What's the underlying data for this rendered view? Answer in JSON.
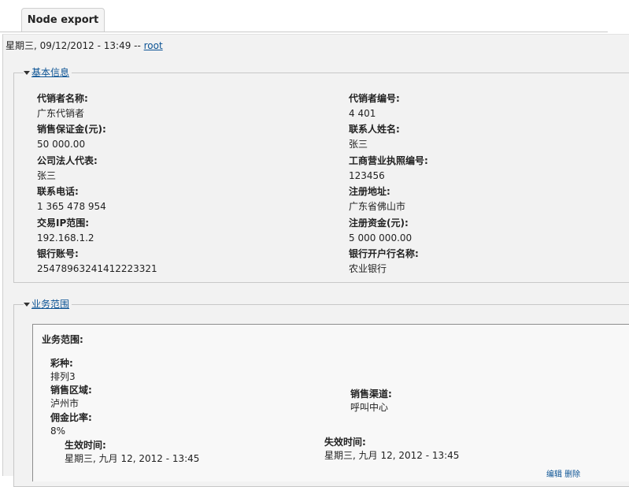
{
  "tab": {
    "label": "Node export"
  },
  "submitted": {
    "text": "星期三, 09/12/2012 - 13:49 -- ",
    "user": "root"
  },
  "basic": {
    "legend": "基本信息",
    "fields": [
      {
        "label": "代销者名称:",
        "value": "广东代销者"
      },
      {
        "label": "代销者编号:",
        "value": "4 401"
      },
      {
        "label": "销售保证金(元):",
        "value": "50 000.00"
      },
      {
        "label": "联系人姓名:",
        "value": "张三"
      },
      {
        "label": "公司法人代表:",
        "value": "张三"
      },
      {
        "label": "工商营业执照编号:",
        "value": "123456"
      },
      {
        "label": "联系电话:",
        "value": "1 365 478 954"
      },
      {
        "label": "注册地址:",
        "value": "广东省佛山市"
      },
      {
        "label": "交易IP范围:",
        "value": "192.168.1.2"
      },
      {
        "label": "注册资金(元):",
        "value": "5 000 000.00"
      },
      {
        "label": "银行账号:",
        "value": "25478963241412223321"
      },
      {
        "label": "银行开户行名称:",
        "value": "农业银行"
      }
    ]
  },
  "scope": {
    "legend": "业务范围",
    "title": "业务范围:",
    "lottery_label": "彩种:",
    "lottery_value": "排列3",
    "region_label": "销售区域:",
    "region_value": "泸州市",
    "channel_label": "销售渠道:",
    "channel_value": "呼叫中心",
    "commission_label": "佣金比率:",
    "commission_value": "8%",
    "start_label": "生效时间:",
    "start_value": "星期三, 九月 12, 2012 - 13:45",
    "end_label": "失效时间:",
    "end_value": "星期三, 九月 12, 2012 - 13:45"
  },
  "footer": {
    "links": "编辑 删除"
  }
}
